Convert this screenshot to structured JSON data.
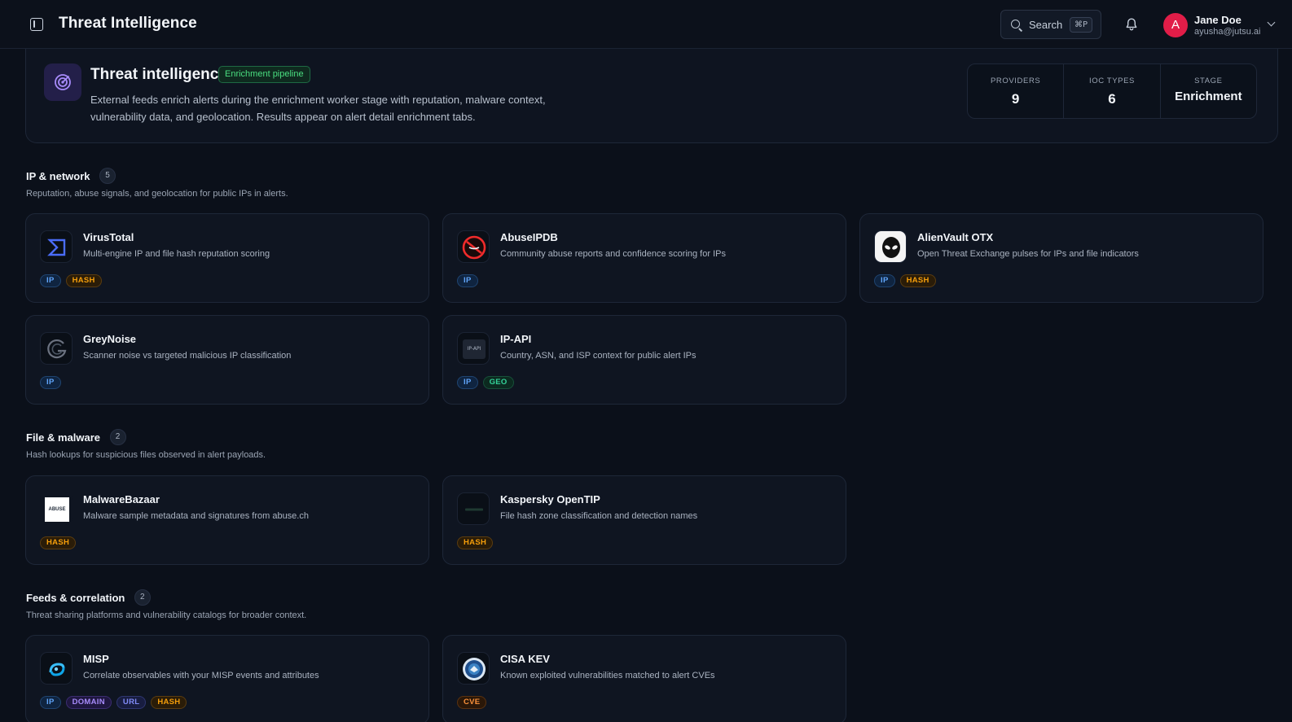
{
  "header": {
    "title": "Threat Intelligence",
    "search_label": "Search",
    "search_shortcut": "⌘P",
    "user_initial": "A",
    "user_name": "Jane Doe",
    "user_email": "ayusha@jutsu.ai"
  },
  "hero": {
    "title": "Threat intelligence",
    "badge": "Enrichment pipeline",
    "description": "External feeds enrich alerts during the enrichment worker stage with reputation, malware context, vulnerability data, and geolocation. Results appear on alert detail enrichment tabs.",
    "stats": [
      {
        "label": "PROVIDERS",
        "value": "9"
      },
      {
        "label": "IOC TYPES",
        "value": "6"
      },
      {
        "label": "STAGE",
        "value": "Enrichment"
      }
    ]
  },
  "sections": [
    {
      "title": "IP & network",
      "count": "5",
      "description": "Reputation, abuse signals, and geolocation for public IPs in alerts.",
      "cards": [
        {
          "name": "VirusTotal",
          "description": "Multi-engine IP and file hash reputation scoring",
          "tags": [
            "IP",
            "HASH"
          ],
          "icon": "virustotal-logo-icon"
        },
        {
          "name": "AbuseIPDB",
          "description": "Community abuse reports and confidence scoring for IPs",
          "tags": [
            "IP"
          ],
          "icon": "abuseipdb-logo-icon"
        },
        {
          "name": "AlienVault OTX",
          "description": "Open Threat Exchange pulses for IPs and file indicators",
          "tags": [
            "IP",
            "HASH"
          ],
          "icon": "alienvault-logo-icon"
        },
        {
          "name": "GreyNoise",
          "description": "Scanner noise vs targeted malicious IP classification",
          "tags": [
            "IP"
          ],
          "icon": "greynoise-logo-icon"
        },
        {
          "name": "IP-API",
          "description": "Country, ASN, and ISP context for public alert IPs",
          "tags": [
            "IP",
            "GEO"
          ],
          "icon": "ip-api-logo-icon",
          "logo_text": "IP-API"
        }
      ]
    },
    {
      "title": "File & malware",
      "count": "2",
      "description": "Hash lookups for suspicious files observed in alert payloads.",
      "cards": [
        {
          "name": "MalwareBazaar",
          "description": "Malware sample metadata and signatures from abuse.ch",
          "tags": [
            "HASH"
          ],
          "icon": "malwarebazaar-logo-icon",
          "logo_text": "ABUSE"
        },
        {
          "name": "Kaspersky OpenTIP",
          "description": "File hash zone classification and detection names",
          "tags": [
            "HASH"
          ],
          "icon": "kaspersky-logo-icon"
        }
      ]
    },
    {
      "title": "Feeds & correlation",
      "count": "2",
      "description": "Threat sharing platforms and vulnerability catalogs for broader context.",
      "cards": [
        {
          "name": "MISP",
          "description": "Correlate observables with your MISP events and attributes",
          "tags": [
            "IP",
            "DOMAIN",
            "URL",
            "HASH"
          ],
          "icon": "misp-logo-icon"
        },
        {
          "name": "CISA KEV",
          "description": "Known exploited vulnerabilities matched to alert CVEs",
          "tags": [
            "CVE"
          ],
          "icon": "cisa-logo-icon"
        }
      ]
    }
  ]
}
